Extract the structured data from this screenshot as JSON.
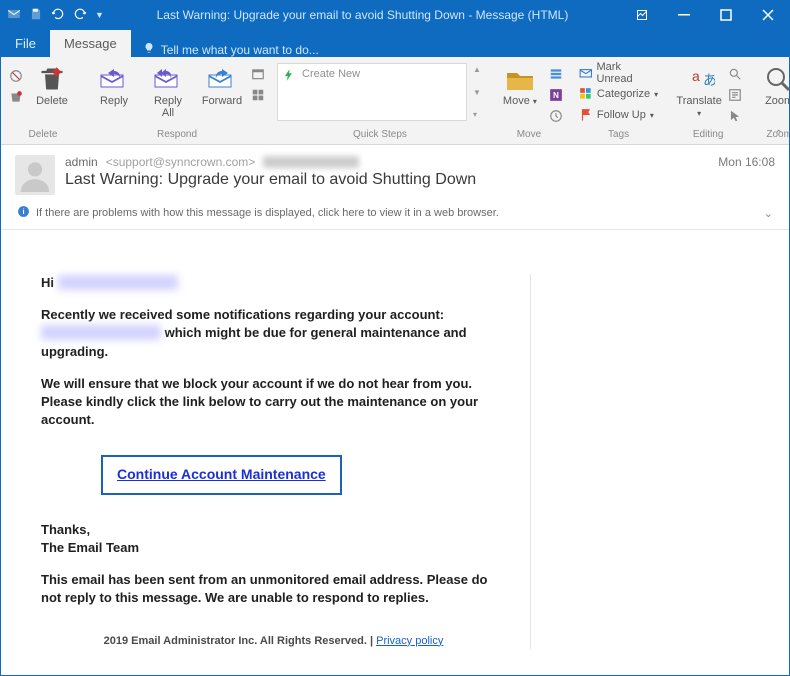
{
  "window": {
    "title": "Last Warning: Upgrade your email to avoid Shutting Down - Message (HTML)"
  },
  "tabs": {
    "file": "File",
    "message": "Message",
    "tellme": "Tell me what you want to do..."
  },
  "ribbon": {
    "delete": {
      "label": "Delete",
      "group": "Delete"
    },
    "respond": {
      "reply": "Reply",
      "replyall": "Reply\nAll",
      "forward": "Forward",
      "group": "Respond"
    },
    "quicksteps": {
      "create": "Create New",
      "group": "Quick Steps"
    },
    "move": {
      "label": "Move",
      "group": "Move"
    },
    "tags": {
      "unread": "Mark Unread",
      "categorize": "Categorize",
      "followup": "Follow Up",
      "group": "Tags"
    },
    "translate": {
      "label": "Translate",
      "group": "Editing"
    },
    "zoom": {
      "label": "Zoom",
      "group": "Zoom"
    }
  },
  "header": {
    "from_display": "admin",
    "from_addr": "<support@synncrown.com>",
    "timestamp": "Mon 16:08",
    "subject": "Last Warning: Upgrade your email to avoid Shutting Down",
    "infobar": "If there are problems with how this message is displayed, click here to view it in a web browser."
  },
  "body": {
    "hi": "Hi ",
    "p1a": "Recently we received some notifications regarding your account: ",
    "p1b": " which might be due for general maintenance and upgrading.",
    "p2": "We will ensure that we block your account if we do not hear from you. Please kindly click the link below to carry out the maintenance on your account.",
    "cta": "Continue Account Maintenance",
    "thanks": "Thanks,",
    "team": "The Email Team",
    "noreply": "This email has been sent from an unmonitored email address. Please do not reply to this message. We are unable to respond to replies.",
    "footer_text": "2019 Email Administrator Inc. All Rights Reserved. | ",
    "footer_link": "Privacy policy"
  }
}
